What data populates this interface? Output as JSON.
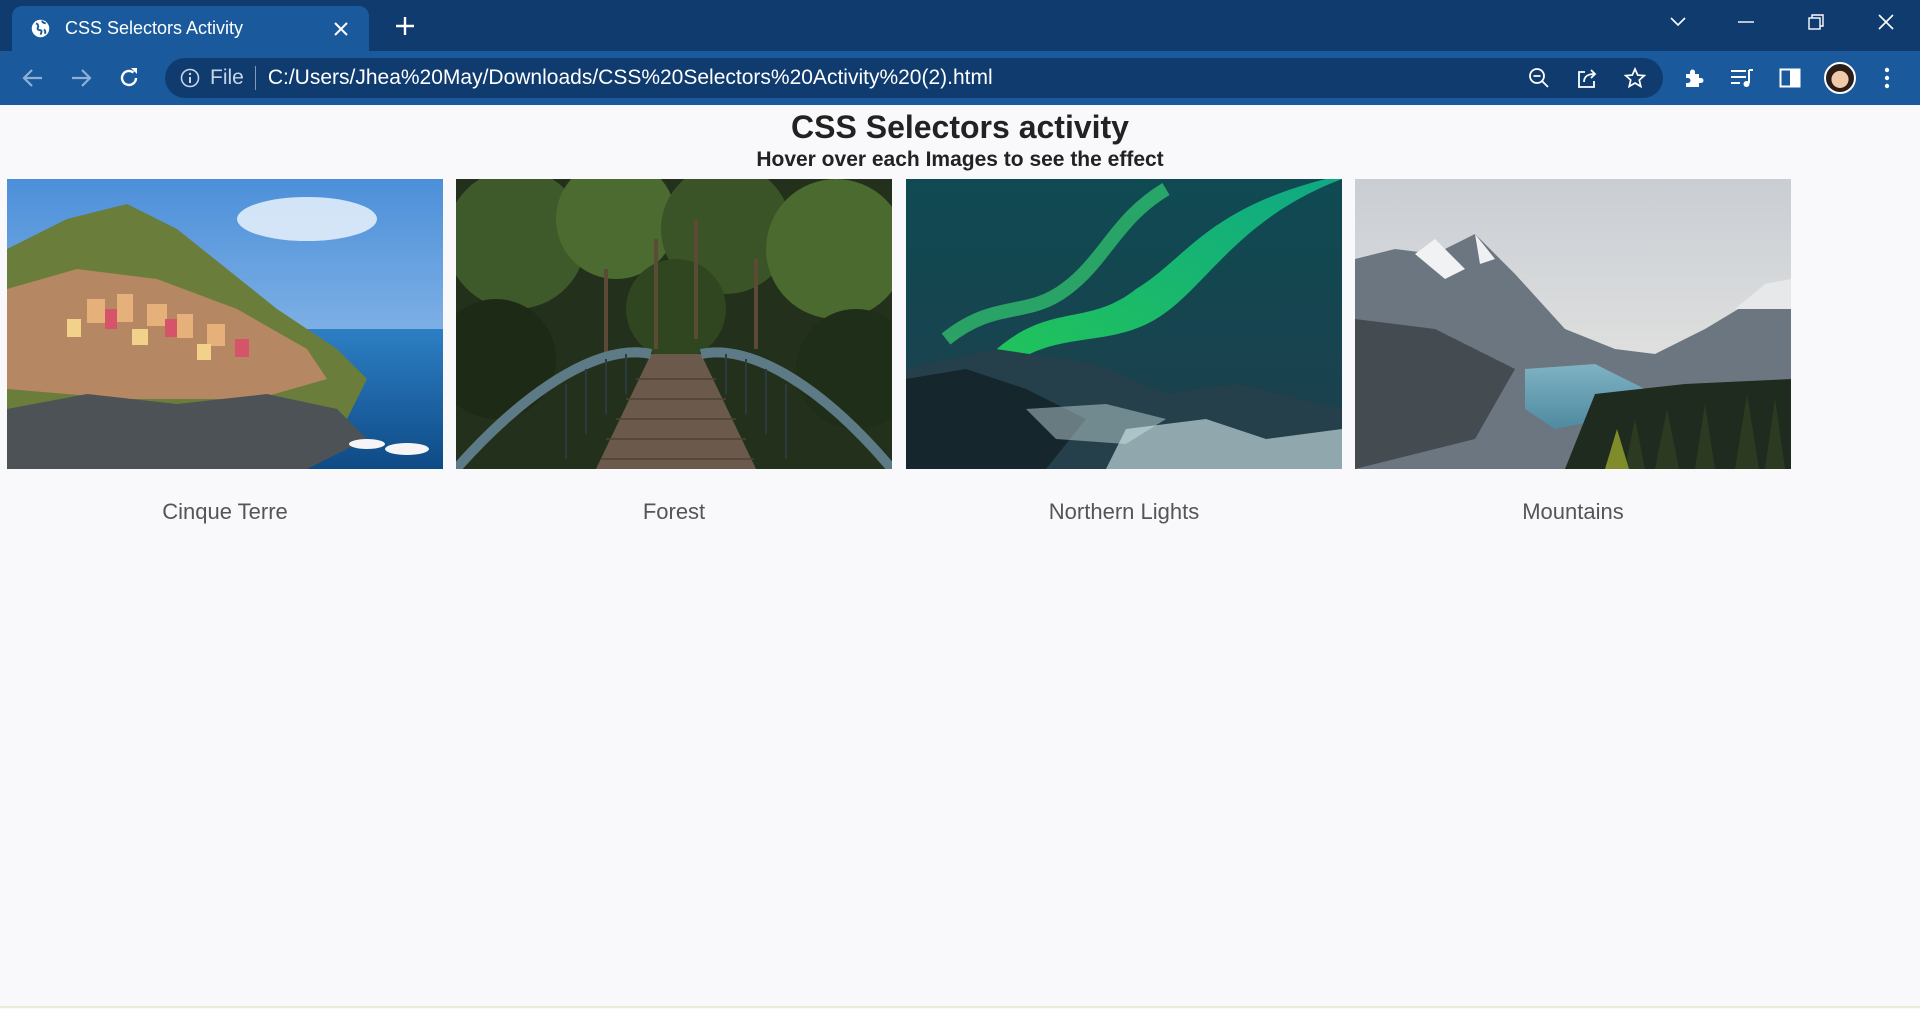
{
  "browser": {
    "tab_title": "CSS Selectors Activity",
    "scheme_label": "File",
    "url": "C:/Users/Jhea%20May/Downloads/CSS%20Selectors%20Activity%20(2).html",
    "icons": [
      "globe-icon",
      "close-icon",
      "plus-icon",
      "chevron-down-icon",
      "minimize-icon",
      "restore-icon",
      "window-close-icon",
      "back-icon",
      "forward-icon",
      "reload-icon",
      "info-icon",
      "zoom-out-icon",
      "share-icon",
      "star-icon",
      "extensions-icon",
      "media-control-icon",
      "side-panel-icon",
      "menu-icon"
    ]
  },
  "page": {
    "title": "CSS Selectors activity",
    "subtitle": "Hover over each Images to see the effect",
    "gallery": [
      {
        "caption": "Cinque Terre",
        "image": "coastal-village-photo"
      },
      {
        "caption": "Forest",
        "image": "forest-bridge-photo"
      },
      {
        "caption": "Northern Lights",
        "image": "aurora-photo"
      },
      {
        "caption": "Mountains",
        "image": "mountain-lake-photo"
      }
    ]
  },
  "colors": {
    "titlebar": "#0f3b6e",
    "tab_active": "#1a5a9c",
    "page_bg": "#f9f9fb"
  }
}
